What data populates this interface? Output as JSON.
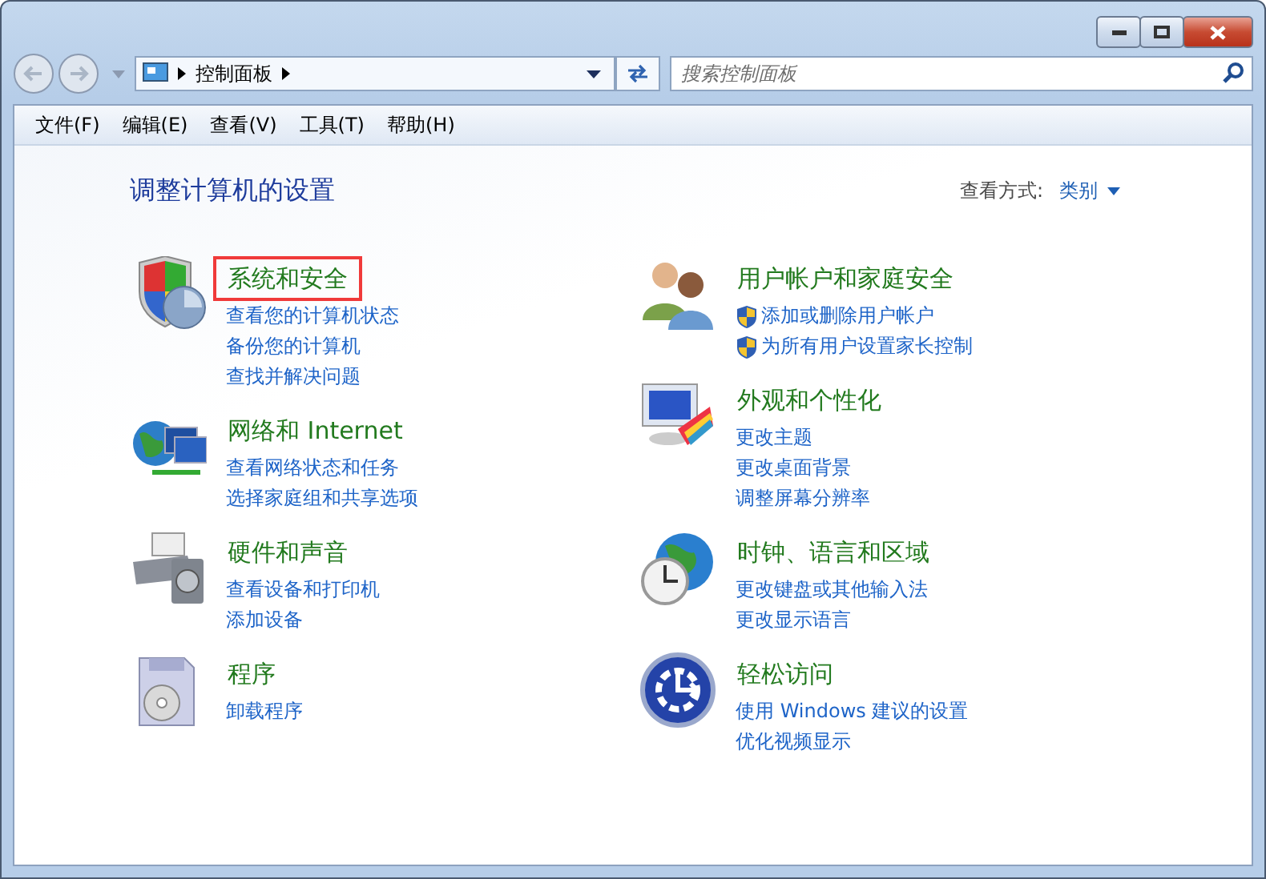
{
  "address_bar": {
    "path": [
      "控制面板"
    ]
  },
  "search": {
    "placeholder": "搜索控制面板"
  },
  "menu": [
    "文件(F)",
    "编辑(E)",
    "查看(V)",
    "工具(T)",
    "帮助(H)"
  ],
  "page_title": "调整计算机的设置",
  "view_by": {
    "label": "查看方式:",
    "value": "类别"
  },
  "columns": [
    [
      {
        "title": "系统和安全",
        "highlighted": true,
        "links": [
          {
            "label": "查看您的计算机状态",
            "kind": "plain"
          },
          {
            "label": "备份您的计算机",
            "kind": "plain"
          },
          {
            "label": "查找并解决问题",
            "kind": "plain"
          }
        ]
      },
      {
        "title": "网络和 Internet",
        "highlighted": false,
        "links": [
          {
            "label": "查看网络状态和任务",
            "kind": "plain"
          },
          {
            "label": "选择家庭组和共享选项",
            "kind": "plain"
          }
        ]
      },
      {
        "title": "硬件和声音",
        "highlighted": false,
        "links": [
          {
            "label": "查看设备和打印机",
            "kind": "plain"
          },
          {
            "label": "添加设备",
            "kind": "plain"
          }
        ]
      },
      {
        "title": "程序",
        "highlighted": false,
        "links": [
          {
            "label": "卸载程序",
            "kind": "plain"
          }
        ]
      }
    ],
    [
      {
        "title": "用户帐户和家庭安全",
        "highlighted": false,
        "links": [
          {
            "label": "添加或删除用户帐户",
            "kind": "shield"
          },
          {
            "label": "为所有用户设置家长控制",
            "kind": "shield"
          }
        ]
      },
      {
        "title": "外观和个性化",
        "highlighted": false,
        "links": [
          {
            "label": "更改主题",
            "kind": "plain"
          },
          {
            "label": "更改桌面背景",
            "kind": "plain"
          },
          {
            "label": "调整屏幕分辨率",
            "kind": "plain"
          }
        ]
      },
      {
        "title": "时钟、语言和区域",
        "highlighted": false,
        "links": [
          {
            "label": "更改键盘或其他输入法",
            "kind": "plain"
          },
          {
            "label": "更改显示语言",
            "kind": "plain"
          }
        ]
      },
      {
        "title": "轻松访问",
        "highlighted": false,
        "links": [
          {
            "label": "使用 Windows 建议的设置",
            "kind": "plain"
          },
          {
            "label": "优化视频显示",
            "kind": "plain"
          }
        ]
      }
    ]
  ]
}
